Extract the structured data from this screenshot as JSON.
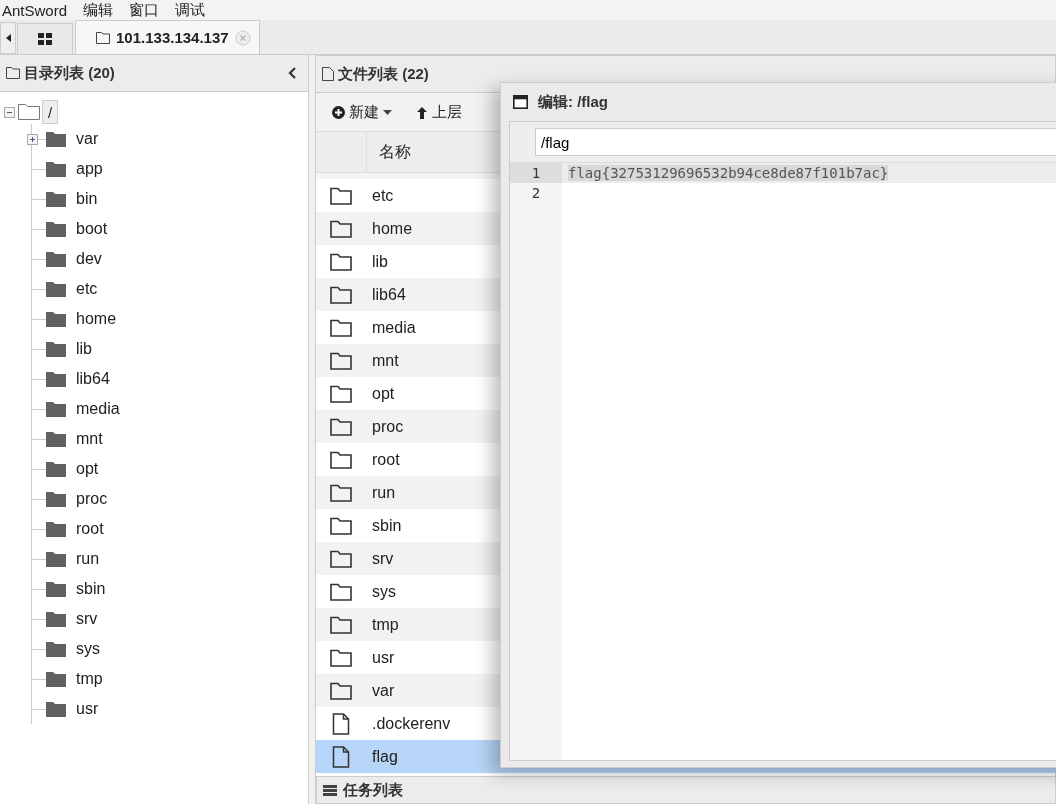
{
  "menu": [
    "AntSword",
    "编辑",
    "窗口",
    "调试"
  ],
  "tabs": [
    {
      "kind": "grid",
      "selected": false
    },
    {
      "kind": "host",
      "label": "101.133.134.137",
      "selected": true
    }
  ],
  "dir_panel": {
    "title": "目录列表 (20)",
    "tree": {
      "label": "/",
      "expanded": true,
      "children": [
        {
          "label": "var",
          "expanded": false
        },
        {
          "label": "app"
        },
        {
          "label": "bin"
        },
        {
          "label": "boot"
        },
        {
          "label": "dev"
        },
        {
          "label": "etc"
        },
        {
          "label": "home"
        },
        {
          "label": "lib"
        },
        {
          "label": "lib64"
        },
        {
          "label": "media"
        },
        {
          "label": "mnt"
        },
        {
          "label": "opt"
        },
        {
          "label": "proc"
        },
        {
          "label": "root"
        },
        {
          "label": "run"
        },
        {
          "label": "sbin"
        },
        {
          "label": "srv"
        },
        {
          "label": "sys"
        },
        {
          "label": "tmp"
        },
        {
          "label": "usr"
        }
      ]
    }
  },
  "file_panel": {
    "title": "文件列表 (22)",
    "toolbar": [
      "新建",
      "上层"
    ],
    "column": "名称",
    "rows": [
      {
        "name": "etc",
        "kind": "folder",
        "selected": false
      },
      {
        "name": "home",
        "kind": "folder",
        "selected": false
      },
      {
        "name": "lib",
        "kind": "folder",
        "selected": false
      },
      {
        "name": "lib64",
        "kind": "folder",
        "selected": false
      },
      {
        "name": "media",
        "kind": "folder",
        "selected": false
      },
      {
        "name": "mnt",
        "kind": "folder",
        "selected": false
      },
      {
        "name": "opt",
        "kind": "folder",
        "selected": false
      },
      {
        "name": "proc",
        "kind": "folder",
        "selected": false
      },
      {
        "name": "root",
        "kind": "folder",
        "selected": false
      },
      {
        "name": "run",
        "kind": "folder",
        "selected": false
      },
      {
        "name": "sbin",
        "kind": "folder",
        "selected": false
      },
      {
        "name": "srv",
        "kind": "folder",
        "selected": false
      },
      {
        "name": "sys",
        "kind": "folder",
        "selected": false
      },
      {
        "name": "tmp",
        "kind": "folder",
        "selected": false
      },
      {
        "name": "usr",
        "kind": "folder",
        "selected": false
      },
      {
        "name": "var",
        "kind": "folder",
        "selected": false
      },
      {
        "name": ".dockerenv",
        "kind": "file",
        "selected": false
      },
      {
        "name": "flag",
        "kind": "file",
        "selected": true
      }
    ]
  },
  "editor": {
    "title": "编辑: /flag",
    "path": "/flag",
    "lines": [
      {
        "number": "1",
        "text": "flag{32753129696532b94ce8de87f101b7ac}",
        "active": true
      },
      {
        "number": "2",
        "active": false
      }
    ]
  },
  "task_panel": {
    "title": "任务列表"
  }
}
